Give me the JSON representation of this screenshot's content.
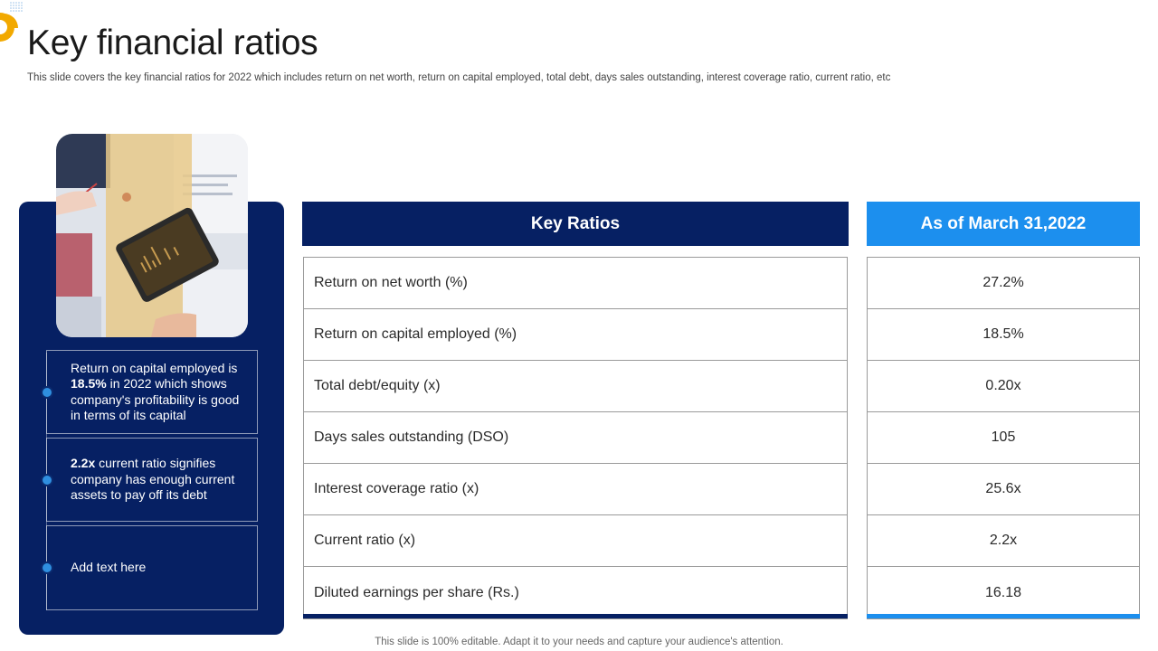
{
  "page": {
    "title": "Key financial ratios",
    "subtitle": "This slide covers the key financial ratios for 2022 which includes return on net worth, return on capital employed, total debt, days sales outstanding, interest coverage ratio, current ratio, etc",
    "footer": "This slide is 100% editable. Adapt it to your needs and capture your audience's attention."
  },
  "colors": {
    "navy": "#062063",
    "accent_blue": "#1c8fee",
    "logo_orange": "#f2a900"
  },
  "left_panel": {
    "boxes": [
      {
        "pre": "Return on capital employed is ",
        "bold": "18.5%",
        "post": " in 2022 which shows company's profitability is good in terms of its capital"
      },
      {
        "pre": "",
        "bold": "2.2x",
        "post": " current ratio signifies company has enough current assets to pay off its debt"
      },
      {
        "pre": "Add text here",
        "bold": "",
        "post": ""
      }
    ]
  },
  "table": {
    "header_left": "Key Ratios",
    "header_right": "As of March 31,2022",
    "rows": [
      {
        "label": "Return on net worth (%)",
        "value": "27.2%"
      },
      {
        "label": "Return on capital employed (%)",
        "value": "18.5%"
      },
      {
        "label": "Total debt/equity (x)",
        "value": "0.20x"
      },
      {
        "label": "Days sales outstanding (DSO)",
        "value": "105"
      },
      {
        "label": "Interest coverage ratio (x)",
        "value": "25.6x"
      },
      {
        "label": "Current ratio (x)",
        "value": "2.2x"
      },
      {
        "label": "Diluted earnings per share (Rs.)",
        "value": "16.18"
      }
    ]
  }
}
